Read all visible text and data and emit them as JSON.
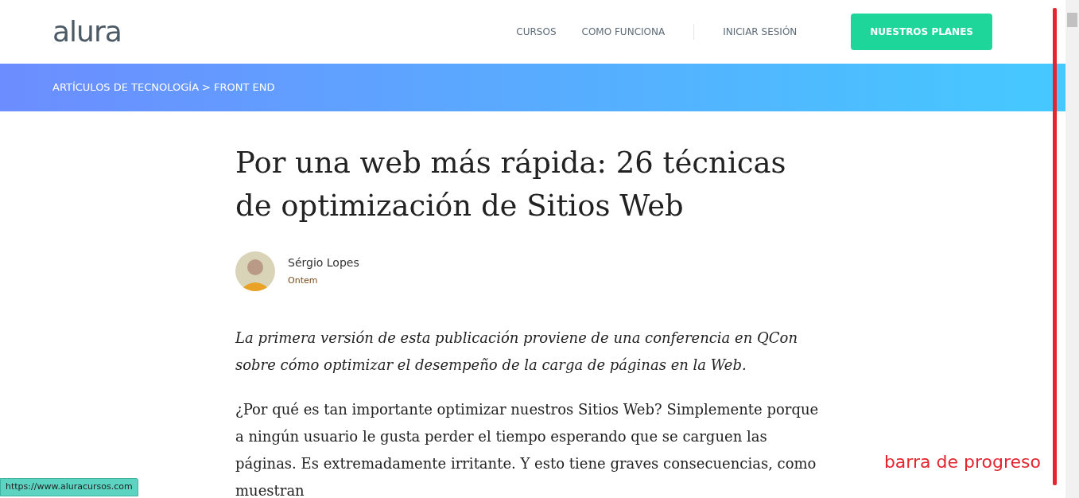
{
  "header": {
    "logo": "alura",
    "nav": [
      {
        "label": "CURSOS"
      },
      {
        "label": "COMO FUNCIONA"
      },
      {
        "label": "INICIAR SESIÓN"
      }
    ],
    "cta": "NUESTROS PLANES"
  },
  "breadcrumb": [
    {
      "label": "ARTÍCULOS DE TECNOLOGÍA"
    },
    {
      "label": "FRONT END"
    }
  ],
  "breadcrumb_separator": ">",
  "article": {
    "title": "Por una web más rápida: 26 técnicas de optimización de Sitios Web",
    "author": {
      "name": "Sérgio Lopes",
      "date": "Ontem"
    },
    "paragraphs": [
      {
        "kind": "intro",
        "text": "La primera versión de esta publicación proviene de una conferencia en QCon sobre cómo optimizar el desempeño de la carga de páginas en la Web."
      },
      {
        "kind": "body",
        "text": "¿Por qué es tan importante optimizar nuestros Sitios Web? Simplemente porque a ningún usuario le gusta perder el tiempo esperando que se carguen las páginas. Es extremadamente irritante. Y esto tiene graves consecuencias, como muestran"
      }
    ]
  },
  "status_url": "https://www.aluracursos.com",
  "annotation": {
    "label": "barra de progreso"
  }
}
